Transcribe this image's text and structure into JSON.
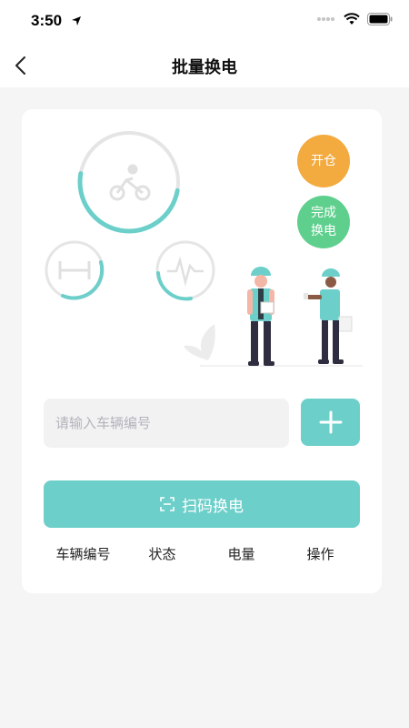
{
  "status": {
    "time": "3:50"
  },
  "nav": {
    "title": "批量换电"
  },
  "actions": {
    "open_label": "开仓",
    "complete_label_1": "完成",
    "complete_label_2": "换电"
  },
  "input": {
    "placeholder": "请输入车辆编号",
    "value": ""
  },
  "scan": {
    "label": "扫码换电"
  },
  "table": {
    "columns": [
      "车辆编号",
      "状态",
      "电量",
      "操作"
    ]
  },
  "colors": {
    "accent": "#6ccfca",
    "orange": "#f3aa3f",
    "green": "#5fcf8d",
    "background": "#f5f5f5"
  },
  "icons": [
    "back-arrow-icon",
    "bicycle-icon",
    "barbell-icon",
    "heartbeat-icon",
    "plus-icon",
    "scan-icon",
    "location-arrow-icon",
    "cellular-signal-icon",
    "wifi-icon",
    "battery-icon"
  ]
}
